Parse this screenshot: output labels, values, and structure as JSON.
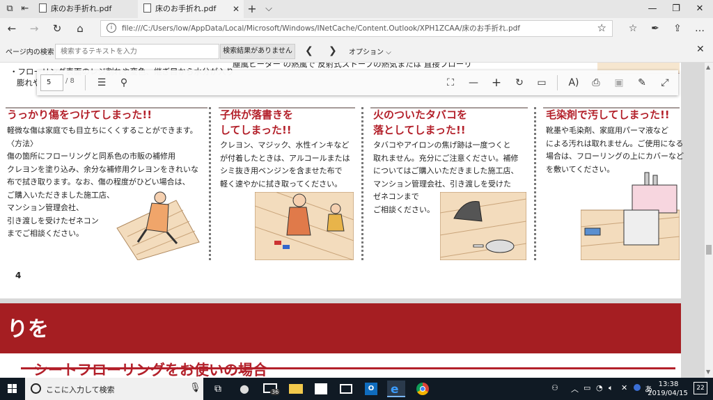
{
  "tabs": [
    {
      "title": "床のお手折れ.pdf",
      "active": false
    },
    {
      "title": "床のお手折れ.pdf",
      "active": true
    }
  ],
  "address": {
    "url": "file:///C:/Users/low/AppData/Local/Microsoft/Windows/INetCache/Content.Outlook/XPH1ZCAA/床のお手折れ.pdf"
  },
  "findbar": {
    "label": "ページ内の検索",
    "placeholder": "検索するテキストを入力",
    "result": "検索結果がありません",
    "options": "オプション"
  },
  "pdf_toolbar": {
    "page": "5",
    "page_count": "/ 8"
  },
  "page_top": {
    "frag1": "・フローリング表面のレジ割れや変色、継ぎ目から水分が入り",
    "frag2": "膨れや",
    "frag3": "塵風ヒーター の熱風で 反射式ストーブの熱気または 直接フローリ"
  },
  "columns": [
    {
      "title": [
        "うっかり傷をつけてしまった!!"
      ],
      "body": "軽微な傷は家庭でも目立ちにくくすることができます。\n〈方法〉\n傷の箇所にフローリングと同系色の市販の補修用\nクレヨンを塗り込み、余分な補修用クレヨンをきれいな\n布で拭き取ります。なお、傷の程度がひどい場合は、\nご購入いただきました施工店、\nマンション管理会社、\n引き渡しを受けたゼネコン\nまでご相談ください。"
    },
    {
      "title": [
        "子供が落書きを",
        "してしまった!!"
      ],
      "body": "クレヨン、マジック、水性インキなど\nが付着したときは、アルコールまたは\nシミ抜き用ベンジンを含ませた布で\n軽く速やかに拭き取ってください。"
    },
    {
      "title": [
        "火のついたタバコを",
        "落としてしまった!!"
      ],
      "body": "タバコやアイロンの焦げ跡は一度つくと\n取れません。充分にご注意ください。補修\nについてはご購入いただきました施工店、\nマンション管理会社、引き渡しを受けた\nゼネコンまで\nご相談ください。"
    },
    {
      "title": [
        "毛染剤で汚してしまった!!"
      ],
      "body": "靴墨や毛染剤、家庭用パーマ液など\nによる汚れは取れません。ご使用になる\n場合は、フローリングの上にカバーなど\nを敷いてください。"
    }
  ],
  "page_number": "4",
  "page2": {
    "big_text": "りを",
    "subtitle": "シートフローリングをお使いの場合"
  },
  "taskbar": {
    "search_placeholder": "ここに入力して検索",
    "mail_badge": "36",
    "time": "13:38",
    "date": "2019/04/15",
    "notification_count": "22"
  }
}
